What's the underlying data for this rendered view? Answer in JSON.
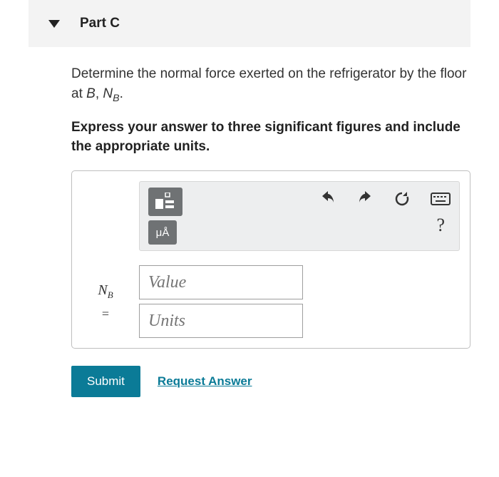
{
  "header": {
    "part_label": "Part C"
  },
  "question": {
    "prompt_pre": "Determine the normal force exerted on the refrigerator by the floor at ",
    "prompt_var1": "B",
    "prompt_mid": ", ",
    "prompt_var2_main": "N",
    "prompt_var2_sub": "B",
    "prompt_post": ".",
    "instruction": "Express your answer to three significant figures and include the appropriate units."
  },
  "toolbar": {
    "templates_label": "templates-icon",
    "special_chars": "μÅ",
    "help": "?"
  },
  "answer": {
    "var_main": "N",
    "var_sub": "B",
    "equals": "=",
    "value_placeholder": "Value",
    "units_placeholder": "Units"
  },
  "actions": {
    "submit": "Submit",
    "request": "Request Answer"
  }
}
